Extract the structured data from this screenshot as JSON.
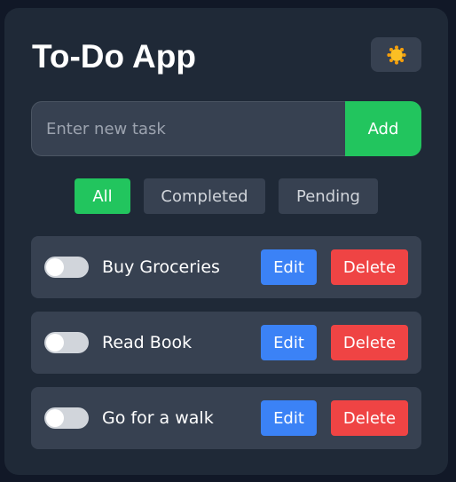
{
  "app": {
    "title": "To-Do App",
    "theme_toggle_icon": "sun-icon"
  },
  "new_task": {
    "placeholder": "Enter new task",
    "value": "",
    "add_label": "Add"
  },
  "filters": [
    {
      "label": "All",
      "active": true
    },
    {
      "label": "Completed",
      "active": false
    },
    {
      "label": "Pending",
      "active": false
    }
  ],
  "tasks": [
    {
      "label": "Buy Groceries",
      "completed": false,
      "edit_label": "Edit",
      "delete_label": "Delete"
    },
    {
      "label": "Read Book",
      "completed": false,
      "edit_label": "Edit",
      "delete_label": "Delete"
    },
    {
      "label": "Go for a walk",
      "completed": false,
      "edit_label": "Edit",
      "delete_label": "Delete"
    }
  ],
  "colors": {
    "background": "#111827",
    "card": "#1f2937",
    "surface": "#374151",
    "accent_green": "#22c55e",
    "edit_blue": "#3b82f6",
    "delete_red": "#ef4444",
    "sun_yellow": "#fbbf24",
    "sun_orange": "#f59e0b"
  }
}
